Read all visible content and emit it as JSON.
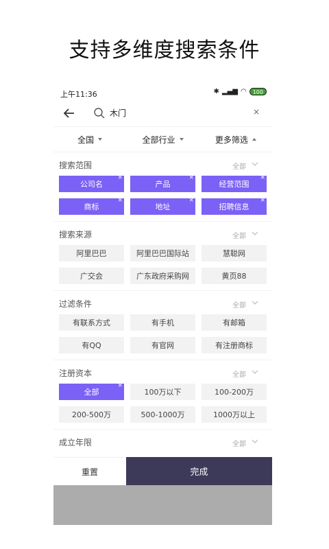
{
  "headline": "支持多维度搜索条件",
  "status": {
    "time": "上午11:36",
    "battery": "100"
  },
  "search": {
    "query": "木门",
    "clear": "×"
  },
  "filters": [
    {
      "label": "全国"
    },
    {
      "label": "全部行业"
    },
    {
      "label": "更多筛选"
    }
  ],
  "sections": [
    {
      "title": "搜索范围",
      "all_label": "全部",
      "chips": [
        {
          "label": "公司名",
          "selected": true
        },
        {
          "label": "产品",
          "selected": true
        },
        {
          "label": "经营范围",
          "selected": true
        },
        {
          "label": "商标",
          "selected": true
        },
        {
          "label": "地址",
          "selected": true
        },
        {
          "label": "招聘信息",
          "selected": true
        }
      ]
    },
    {
      "title": "搜索来源",
      "all_label": "全部",
      "chips": [
        {
          "label": "阿里巴巴",
          "selected": false
        },
        {
          "label": "阿里巴巴国际站",
          "selected": false
        },
        {
          "label": "慧聪网",
          "selected": false
        },
        {
          "label": "广交会",
          "selected": false
        },
        {
          "label": "广东政府采购网",
          "selected": false
        },
        {
          "label": "黄页88",
          "selected": false
        }
      ]
    },
    {
      "title": "过滤条件",
      "all_label": "全部",
      "chips": [
        {
          "label": "有联系方式",
          "selected": false
        },
        {
          "label": "有手机",
          "selected": false
        },
        {
          "label": "有邮箱",
          "selected": false
        },
        {
          "label": "有QQ",
          "selected": false
        },
        {
          "label": "有官网",
          "selected": false
        },
        {
          "label": "有注册商标",
          "selected": false
        }
      ]
    },
    {
      "title": "注册资本",
      "all_label": "全部",
      "chips": [
        {
          "label": "全部",
          "selected": true
        },
        {
          "label": "100万以下",
          "selected": false
        },
        {
          "label": "100-200万",
          "selected": false
        },
        {
          "label": "200-500万",
          "selected": false
        },
        {
          "label": "500-1000万",
          "selected": false
        },
        {
          "label": "1000万以上",
          "selected": false
        }
      ]
    },
    {
      "title": "成立年限",
      "all_label": "全部",
      "chips": []
    }
  ],
  "chip_close": "×",
  "footer": {
    "reset": "重置",
    "done": "完成"
  },
  "colors": {
    "accent": "#7b61f5",
    "done_bg": "#3d3a59"
  }
}
